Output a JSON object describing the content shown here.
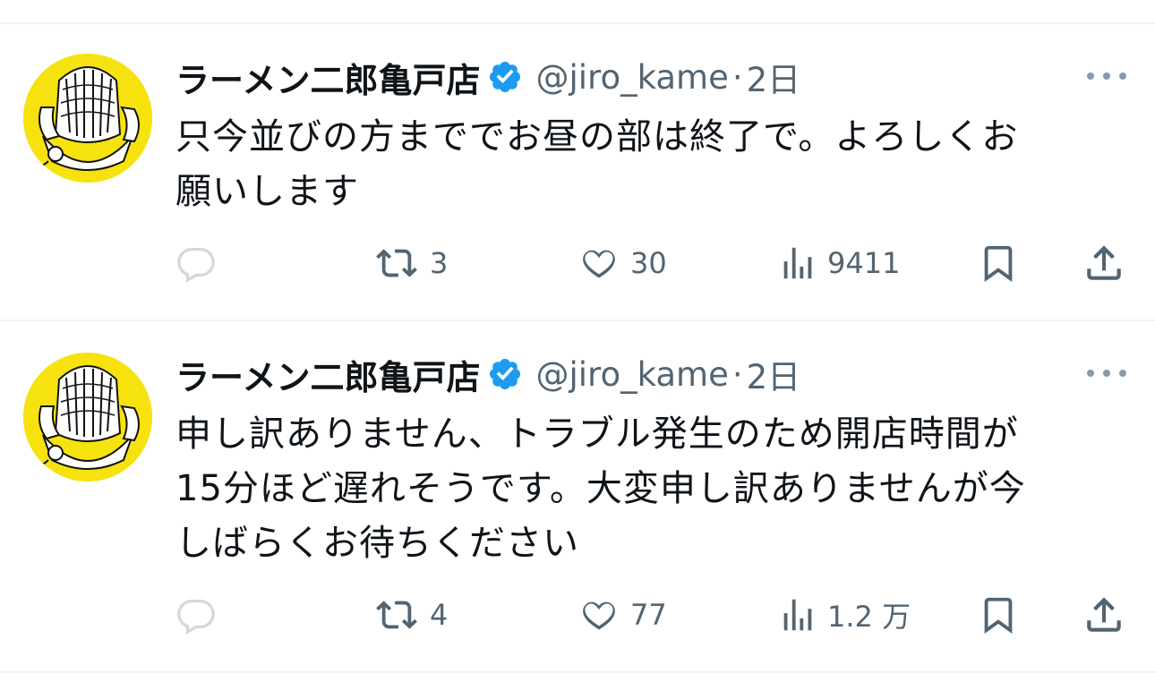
{
  "tweets": [
    {
      "author_name": "ラーメン二郎亀戸店",
      "handle": "@jiro_kame",
      "separator": "·",
      "time": "2日",
      "text_lines": [
        "只今並びの方まででお昼の部は終了で。よろしくお",
        "願いします"
      ],
      "replies": "",
      "retweets": "3",
      "likes": "30",
      "views": "9411"
    },
    {
      "author_name": "ラーメン二郎亀戸店",
      "handle": "@jiro_kame",
      "separator": "·",
      "time": "2日",
      "text_lines": [
        "申し訳ありません、トラブル発生のため開店時間が",
        "15分ほど遅れそうです。大変申し訳ありませんが今",
        "しばらくお待ちください"
      ],
      "replies": "",
      "retweets": "4",
      "likes": "77",
      "views": "1.2 万"
    }
  ],
  "icons": {
    "verified": "verified-badge-icon",
    "more": "more-dots-icon",
    "reply": "reply-bubble-icon",
    "retweet": "retweet-icon",
    "like": "heart-icon",
    "views": "views-bar-chart-icon",
    "bookmark": "bookmark-icon",
    "share": "share-upload-icon"
  },
  "colors": {
    "verified": "#1d9bf0",
    "secondary_text": "#536471",
    "avatar_bg": "#f6e20f",
    "divider": "#eff3f4",
    "reply_icon": "#cfd9de"
  }
}
